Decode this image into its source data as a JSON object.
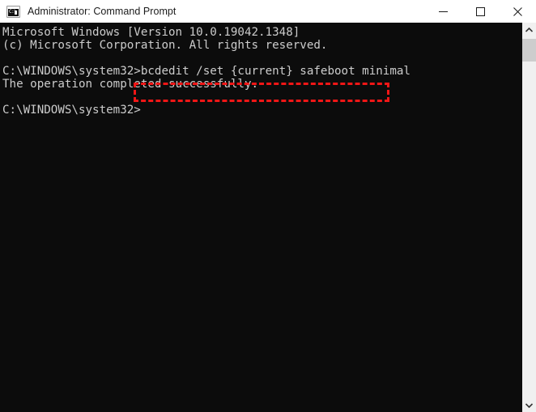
{
  "window": {
    "title": "Administrator: Command Prompt",
    "app_icon": "command-prompt-icon",
    "icon_text": "C:\\",
    "background_color": "#0c0c0c",
    "titlebar_color": "#ffffff"
  },
  "controls": {
    "minimize_label": "Minimize",
    "maximize_label": "Maximize",
    "close_label": "Close"
  },
  "console": {
    "text": "Microsoft Windows [Version 10.0.19042.1348]\n(c) Microsoft Corporation. All rights reserved.\n\nC:\\WINDOWS\\system32>bcdedit /set {current} safeboot minimal\nThe operation completed successfully.\n\nC:\\WINDOWS\\system32>",
    "lines": [
      "Microsoft Windows [Version 10.0.19042.1348]",
      "(c) Microsoft Corporation. All rights reserved.",
      "",
      "C:\\WINDOWS\\system32>bcdedit /set {current} safeboot minimal",
      "The operation completed successfully.",
      "",
      "C:\\WINDOWS\\system32>"
    ],
    "prompt": "C:\\WINDOWS\\system32>",
    "command": "bcdedit /set {current} safeboot minimal",
    "result": "The operation completed successfully.",
    "version_line": "Microsoft Windows [Version 10.0.19042.1348]",
    "copyright_line": "(c) Microsoft Corporation. All rights reserved.",
    "text_color": "#cccccc"
  },
  "highlight": {
    "target": "bcdedit /set {current} safeboot minimal",
    "color": "#f21616",
    "style": "dashed"
  },
  "scrollbar": {
    "up_arrow": "chevron-up-icon",
    "down_arrow": "chevron-down-icon",
    "thumb_color": "#cdcdcd",
    "track_color": "#f0f0f0"
  }
}
